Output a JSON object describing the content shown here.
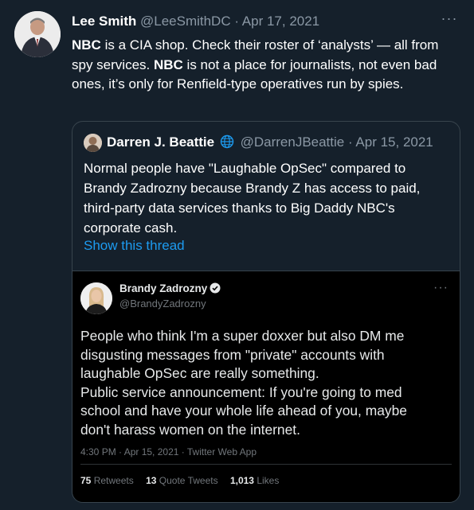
{
  "tweet": {
    "author_name": "Lee Smith",
    "author_meta": "@LeeSmithDC · Apr 17, 2021",
    "body_line1_bold": "NBC",
    "body_line1_rest": " is a CIA shop. Check their roster of ‘analysts’ — all from spy services. ",
    "body_line2_bold": "NBC",
    "body_line2_rest": " is not a place for journalists, not even bad ones, it’s only for Renfield-type operatives run by spies.",
    "more_label": "···"
  },
  "quote": {
    "author_name": "Darren J. Beattie",
    "author_meta": "@DarrenJBeattie · Apr 15, 2021",
    "body": "Normal people have \"Laughable OpSec\"  compared to Brandy Zadrozny because Brandy Z has access to paid, third-party data services thanks to Big Daddy NBC's corporate cash.",
    "show_thread": "Show this thread"
  },
  "embedded": {
    "author_name": "Brandy Zadrozny",
    "handle": "@BrandyZadrozny",
    "more_label": "···",
    "body_lines": [
      "People who think I'm a super doxxer but also DM me",
      "disgusting messages from \"private\" accounts with",
      "laughable OpSec are really something.",
      "Public service announcement: If you're going to med",
      "school and have your whole life ahead of you, maybe",
      "don't harass women on the internet."
    ],
    "timestamp": "4:30 PM · Apr 15, 2021 · Twitter Web App",
    "retweets_count": "75",
    "retweets_label": "Retweets",
    "quote_count": "13",
    "quote_label": "Quote Tweets",
    "likes_count": "1,013",
    "likes_label": "Likes"
  },
  "colors": {
    "background": "#15202b",
    "link": "#1d9bf0",
    "muted": "#8b98a5"
  }
}
